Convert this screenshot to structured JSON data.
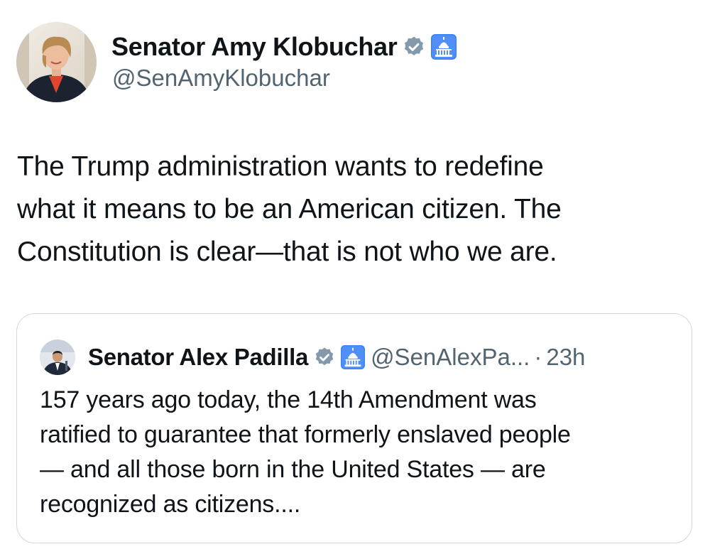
{
  "tweet": {
    "author": {
      "name": "Senator Amy Klobuchar",
      "handle": "@SenAmyKlobuchar"
    },
    "text": "The Trump administration wants to redefine\nwhat it means to be an American citizen. The\nConstitution is clear—that is not who we are.",
    "colors": {
      "verified_badge": "#829aab",
      "gov_badge_bg": "#3b82f6",
      "text": "#0f1419",
      "secondary_text": "#536471",
      "card_border": "#cfd9de"
    },
    "badges": [
      "verified-badge-icon",
      "government-capitol-icon"
    ]
  },
  "quote": {
    "author": {
      "name": "Senator Alex Padilla",
      "handle": "@SenAlexPa...",
      "separator": "·",
      "time": "23h"
    },
    "text": "157 years ago today, the 14th Amendment was\nratified to guarantee that formerly enslaved people\n— and all those born in the United States — are\nrecognized as citizens...."
  }
}
